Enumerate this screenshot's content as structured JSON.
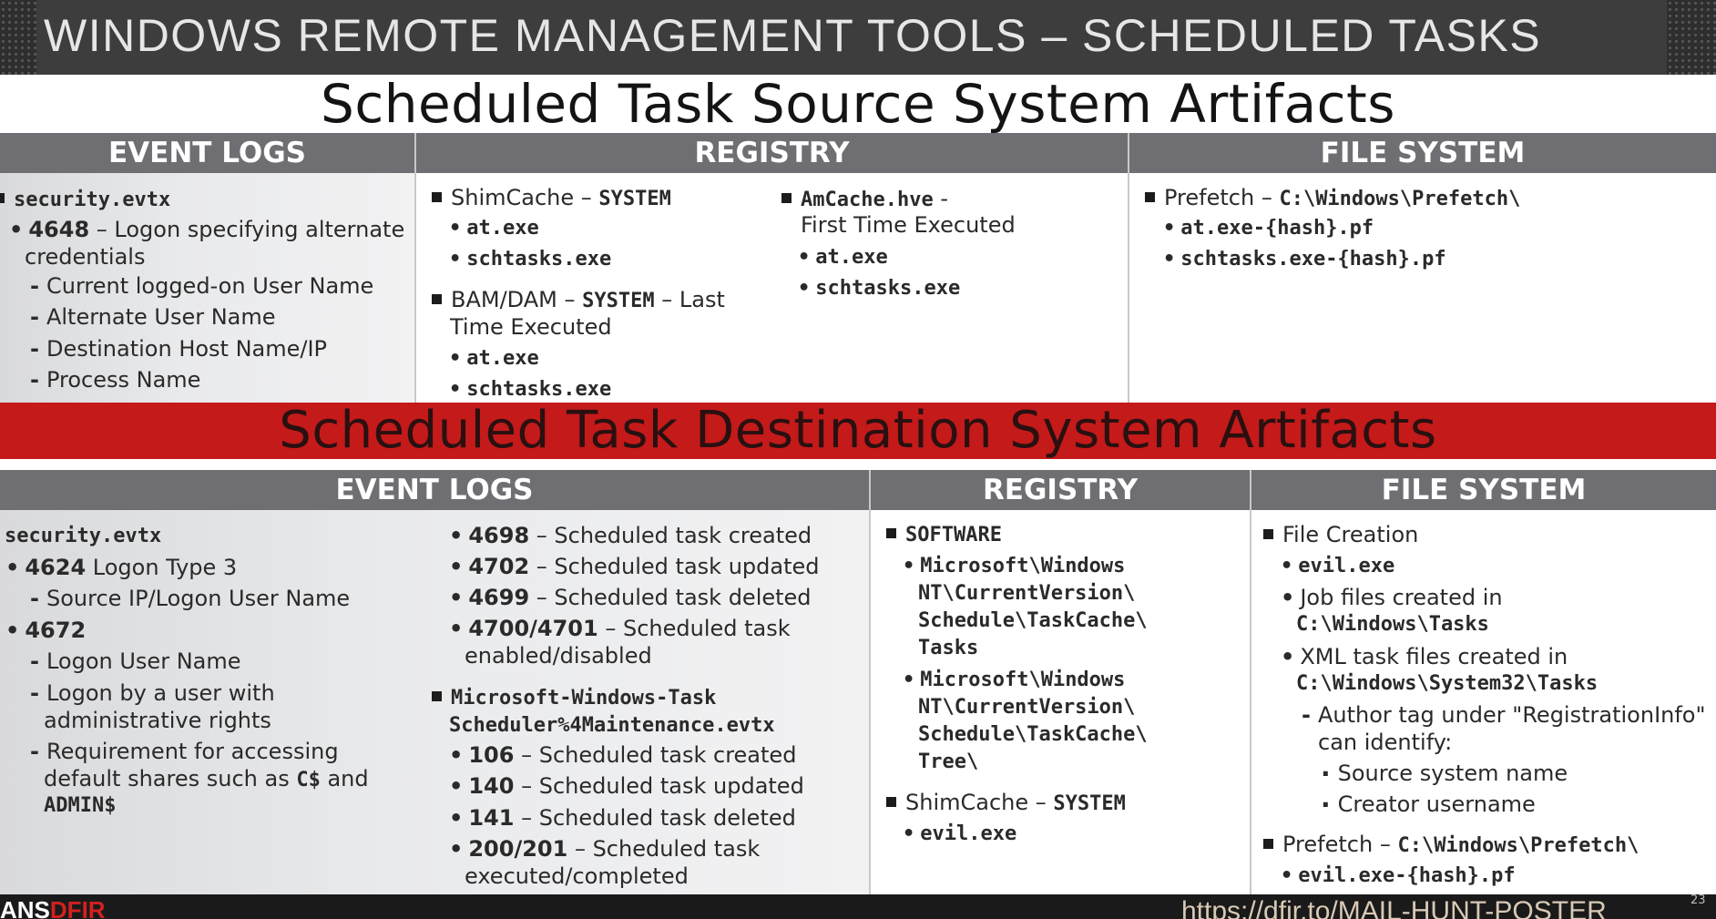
{
  "header": {
    "title": "WINDOWS REMOTE MANAGEMENT TOOLS – SCHEDULED TASKS"
  },
  "source": {
    "title": "Scheduled Task Source System Artifacts",
    "event_logs": {
      "heading": "EVENT LOGS",
      "lines": [
        {
          "text": "security.evtx"
        },
        {
          "id": "4648",
          "text": " – Logon specifying alternate"
        },
        {
          "text": "credentials"
        },
        {
          "text": "Current logged-on User Name"
        },
        {
          "text": "Alternate User Name"
        },
        {
          "text": "Destination Host Name/IP"
        },
        {
          "text": "Process Name"
        }
      ]
    },
    "registry": {
      "heading": "REGISTRY",
      "shimcache": {
        "label": "ShimCache – ",
        "hive": "SYSTEM",
        "items": [
          "at.exe",
          "schtasks.exe"
        ]
      },
      "bam": {
        "label1": "BAM/DAM – ",
        "hive": "SYSTEM",
        "label2": " – Last",
        "label3": "Time Executed",
        "items": [
          "at.exe",
          "schtasks.exe"
        ]
      },
      "amcache": {
        "label": "AmCache.hve",
        "suffix": " -",
        "label2": "First Time Executed",
        "items": [
          "at.exe",
          "schtasks.exe"
        ]
      }
    },
    "file_system": {
      "heading": "FILE SYSTEM",
      "prefetch_label": "Prefetch – ",
      "prefetch_path": "C:\\Windows\\Prefetch\\",
      "items": [
        "at.exe-{hash}.pf",
        "schtasks.exe-{hash}.pf"
      ]
    }
  },
  "destination": {
    "title": "Scheduled Task Destination System Artifacts",
    "event_logs": {
      "heading": "EVENT LOGS",
      "security": "security.evtx",
      "e4624": {
        "id": "4624",
        "text": " Logon Type 3"
      },
      "e4624_sub": "Source IP/Logon User Name",
      "e4672": "4672",
      "e4672_subs": [
        "Logon User Name",
        "Logon by a user with",
        "administrative rights",
        "Requirement for accessing",
        "default shares such as "
      ],
      "share_c": "C$",
      "share_and": " and",
      "share_admin": "ADMIN$",
      "task_events": [
        {
          "id": "4698",
          "text": " – Scheduled task created"
        },
        {
          "id": "4702",
          "text": " – Scheduled task updated"
        },
        {
          "id": "4699",
          "text": " – Scheduled task deleted"
        },
        {
          "id": "4700/4701",
          "text": " – Scheduled task"
        }
      ],
      "task_events_cont": "enabled/disabled",
      "maint_log1": "Microsoft-Windows-Task",
      "maint_log2": "Scheduler%4Maintenance.evtx",
      "maint_events": [
        {
          "id": "106",
          "text": " – Scheduled task created"
        },
        {
          "id": "140",
          "text": " – Scheduled task updated"
        },
        {
          "id": "141",
          "text": " – Scheduled task deleted"
        },
        {
          "id": "200/201",
          "text": " – Scheduled task"
        }
      ],
      "maint_events_cont": "executed/completed"
    },
    "registry": {
      "heading": "REGISTRY",
      "software": "SOFTWARE",
      "key1": [
        "Microsoft\\Windows",
        "NT\\CurrentVersion\\",
        "Schedule\\TaskCache\\",
        "Tasks"
      ],
      "key2": [
        "Microsoft\\Windows",
        "NT\\CurrentVersion\\",
        "Schedule\\TaskCache\\",
        "Tree\\"
      ],
      "shim_label": "ShimCache – ",
      "shim_hive": "SYSTEM",
      "shim_item": "evil.exe"
    },
    "file_system": {
      "heading": "FILE SYSTEM",
      "file_creation": "File Creation",
      "evil": "evil.exe",
      "job1": "Job files created in",
      "job2": "C:\\Windows\\Tasks",
      "xml1": "XML task files created in",
      "xml2": "C:\\Windows\\System32\\Tasks",
      "author1": "Author tag under \"RegistrationInfo\"",
      "author2": "can identify:",
      "author_items": [
        "Source system name",
        "Creator username"
      ],
      "prefetch_label": "Prefetch – ",
      "prefetch_path": "C:\\Windows\\Prefetch\\",
      "prefetch_item": "evil.exe-{hash}.pf"
    }
  },
  "footer": {
    "logo_prefix": "ANS",
    "logo_brand": "DFIR",
    "url": "https://dfir.to/MAIL-HUNT-POSTER",
    "slide_number": "23"
  }
}
